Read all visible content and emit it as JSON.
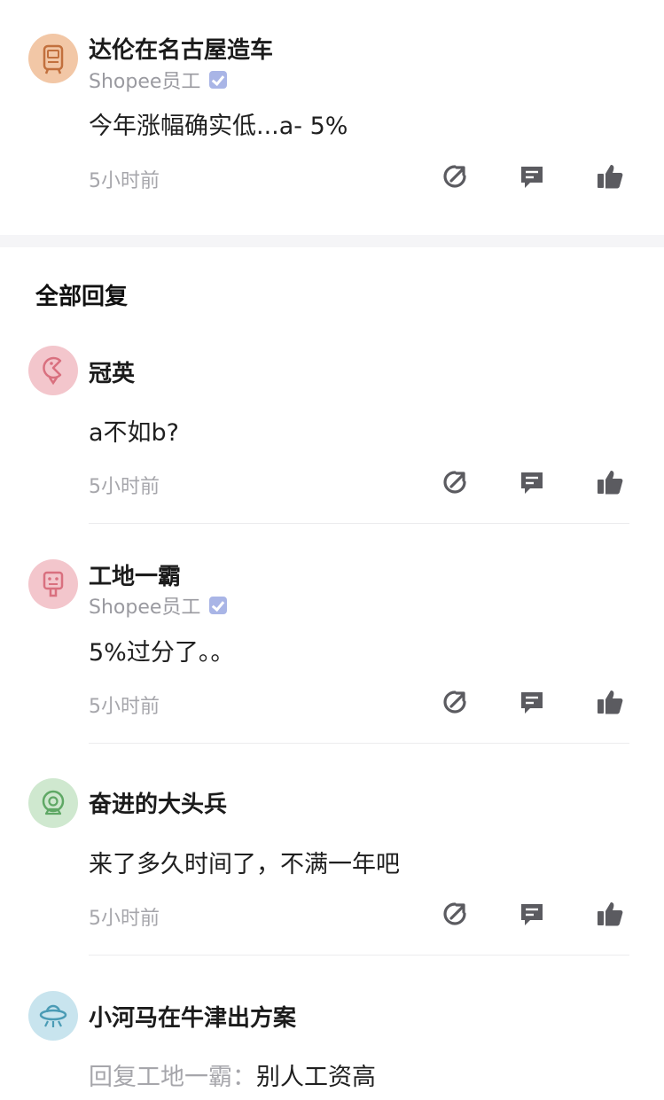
{
  "post": {
    "author": "达伦在名古屋造车",
    "badge_label": "Shopee员工",
    "content": "今年涨幅确实低...a- 5%",
    "time": "5小时前"
  },
  "section_title": "全部回复",
  "replies": [
    {
      "author": "冠英",
      "content": "a不如b?",
      "time": "5小时前"
    },
    {
      "author": "工地一霸",
      "badge_label": "Shopee员工",
      "content": "5%过分了。。",
      "time": "5小时前"
    },
    {
      "author": "奋进的大头兵",
      "content": "来了多久时间了，不满一年吧",
      "time": "5小时前"
    },
    {
      "author": "小河马在牛津出方案",
      "reply_prefix": "回复工地一霸：",
      "content": "别人工资高"
    }
  ],
  "icons": {
    "share": "share-icon",
    "comment": "comment-icon",
    "like": "thumbs-up-icon"
  },
  "colors": {
    "avatar_orange": "#f2c7a6",
    "avatar_pink": "#f3c6cc",
    "avatar_green": "#cfe8cf",
    "avatar_blue": "#c8e4ee",
    "badge": "#a9b5e6",
    "muted_text": "#a6a6ab",
    "icon": "#5b5b60"
  }
}
